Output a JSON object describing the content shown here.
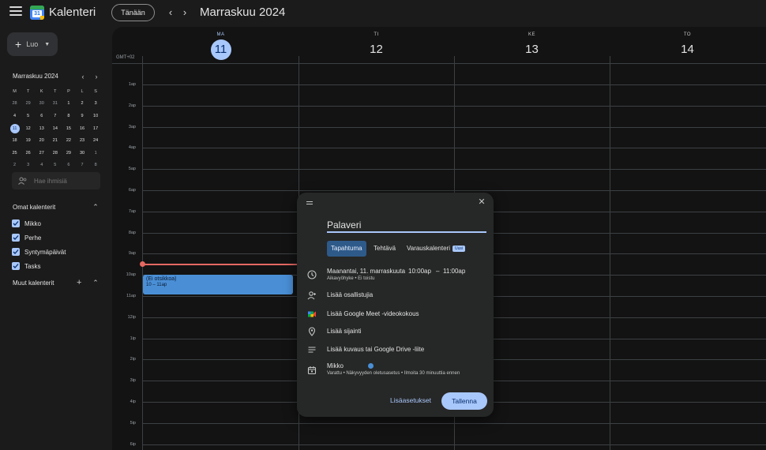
{
  "header": {
    "app_title": "Kalenteri",
    "logo_day": "31",
    "today_label": "Tänään",
    "month_title": "Marraskuu 2024"
  },
  "sidebar": {
    "create_label": "Luo",
    "mini_calendar": {
      "title": "Marraskuu 2024",
      "weekdays": [
        "M",
        "T",
        "K",
        "T",
        "P",
        "L",
        "S"
      ],
      "weeks": [
        [
          {
            "d": "28",
            "dim": true
          },
          {
            "d": "29",
            "dim": true
          },
          {
            "d": "30",
            "dim": true
          },
          {
            "d": "31",
            "dim": true
          },
          {
            "d": "1"
          },
          {
            "d": "2"
          },
          {
            "d": "3"
          }
        ],
        [
          {
            "d": "4"
          },
          {
            "d": "5"
          },
          {
            "d": "6"
          },
          {
            "d": "7"
          },
          {
            "d": "8"
          },
          {
            "d": "9"
          },
          {
            "d": "10"
          }
        ],
        [
          {
            "d": "11",
            "sel": true
          },
          {
            "d": "12"
          },
          {
            "d": "13"
          },
          {
            "d": "14"
          },
          {
            "d": "15"
          },
          {
            "d": "16"
          },
          {
            "d": "17"
          }
        ],
        [
          {
            "d": "18"
          },
          {
            "d": "19"
          },
          {
            "d": "20"
          },
          {
            "d": "21"
          },
          {
            "d": "22"
          },
          {
            "d": "23"
          },
          {
            "d": "24"
          }
        ],
        [
          {
            "d": "25"
          },
          {
            "d": "26"
          },
          {
            "d": "27"
          },
          {
            "d": "28"
          },
          {
            "d": "29"
          },
          {
            "d": "30"
          },
          {
            "d": "1",
            "dim": true
          }
        ],
        [
          {
            "d": "2",
            "dim": true
          },
          {
            "d": "3",
            "dim": true
          },
          {
            "d": "4",
            "dim": true
          },
          {
            "d": "5",
            "dim": true
          },
          {
            "d": "6",
            "dim": true
          },
          {
            "d": "7",
            "dim": true
          },
          {
            "d": "8",
            "dim": true
          }
        ]
      ]
    },
    "search_people_placeholder": "Hae ihmisiä",
    "my_calendars_title": "Omat kalenterit",
    "my_calendars": [
      "Mikko",
      "Perhe",
      "Syntymäpäivät",
      "Tasks"
    ],
    "other_calendars_title": "Muut kalenterit"
  },
  "grid": {
    "timezone": "GMT+02",
    "days": [
      {
        "dow": "MA",
        "num": "11",
        "today": true
      },
      {
        "dow": "TI",
        "num": "12"
      },
      {
        "dow": "KE",
        "num": "13"
      },
      {
        "dow": "TO",
        "num": "14"
      }
    ],
    "hours": [
      "1ap",
      "2ap",
      "3ap",
      "4ap",
      "5ap",
      "6ap",
      "7ap",
      "8ap",
      "9ap",
      "10ap",
      "11ap",
      "12ip",
      "1ip",
      "2ip",
      "3ip",
      "4ip",
      "5ip",
      "6ip"
    ],
    "event": {
      "title": "(Ei otsikkoa)",
      "time": "10 – 11ap"
    }
  },
  "dialog": {
    "title_value": "Palaveri",
    "tabs": {
      "event": "Tapahtuma",
      "task": "Tehtävä",
      "booking": "Varauskalenteri",
      "new_badge": "Uusi"
    },
    "date": "Maanantai, 11. marraskuuta",
    "start": "10:00ap",
    "dash": "–",
    "end": "11:00ap",
    "date_sub": "Aikavyöhyke • Ei toistu",
    "add_guests": "Lisää osallistujia",
    "add_meet": "Lisää Google Meet -videokokous",
    "add_location": "Lisää sijainti",
    "add_description": "Lisää kuvaus tai Google Drive -liite",
    "owner": "Mikko",
    "owner_sub": "Varattu • Näkyvyyden oletusasetus • Ilmoita 30 minuuttia ennen",
    "more_options": "Lisäasetukset",
    "save": "Tallenna"
  }
}
